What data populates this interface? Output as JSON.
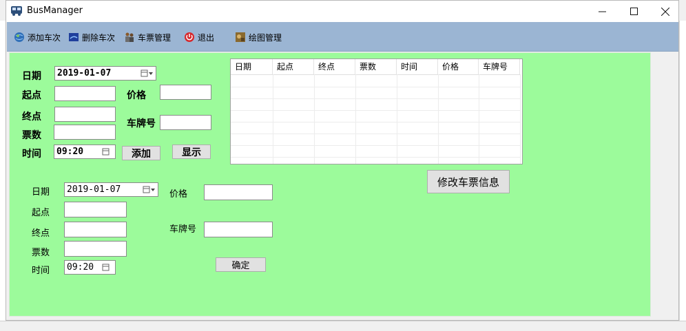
{
  "window": {
    "title": "BusManager"
  },
  "toolbar": {
    "items": [
      {
        "label": "添加车次",
        "icon": "globe-icon"
      },
      {
        "label": "删除车次",
        "icon": "blue-card-icon"
      },
      {
        "label": "车票管理",
        "icon": "people-icon"
      },
      {
        "label": "退出",
        "icon": "power-icon"
      },
      {
        "label": "绘图管理",
        "icon": "paint-icon"
      }
    ]
  },
  "add_form": {
    "date_label": "日期",
    "date_value": "2019-01-07",
    "start_label": "起点",
    "price_label": "价格",
    "end_label": "终点",
    "plate_label": "车牌号",
    "count_label": "票数",
    "time_label": "时间",
    "time_value": "09:20",
    "add_button": "添加",
    "show_button": "显示"
  },
  "table": {
    "columns": [
      "日期",
      "起点",
      "终点",
      "票数",
      "时间",
      "价格",
      "车牌号"
    ],
    "rows": []
  },
  "edit": {
    "modify_button": "修改车票信息",
    "date_label": "日期",
    "date_value": "2019-01-07",
    "price_label": "价格",
    "start_label": "起点",
    "end_label": "终点",
    "plate_label": "车牌号",
    "count_label": "票数",
    "time_label": "时间",
    "time_value": "09:20",
    "confirm_button": "确定"
  },
  "colors": {
    "panel": "#9cfb9b",
    "toolbar": "#9bb5d3"
  }
}
